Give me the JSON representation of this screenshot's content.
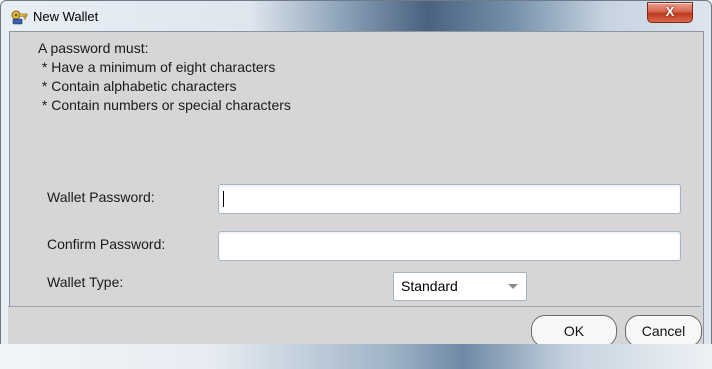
{
  "window": {
    "title": "New Wallet",
    "close_label": "X"
  },
  "info": {
    "heading": "A password must:",
    "rules": [
      " * Have a minimum of eight characters",
      " * Contain alphabetic characters",
      " * Contain numbers or special characters"
    ]
  },
  "form": {
    "password_label": "Wallet Password:",
    "password_value": "",
    "confirm_label": "Confirm Password:",
    "confirm_value": "",
    "type_label": "Wallet Type:",
    "type_selected": "Standard"
  },
  "buttons": {
    "ok_label": "OK",
    "cancel_label": "Cancel"
  },
  "colors": {
    "panel_bg": "#d6d6d6",
    "close_red": "#c0391e"
  },
  "icons": {
    "app_icon": "key-wallet-icon",
    "close_icon": "close-icon",
    "dropdown_icon": "chevron-down-icon"
  }
}
